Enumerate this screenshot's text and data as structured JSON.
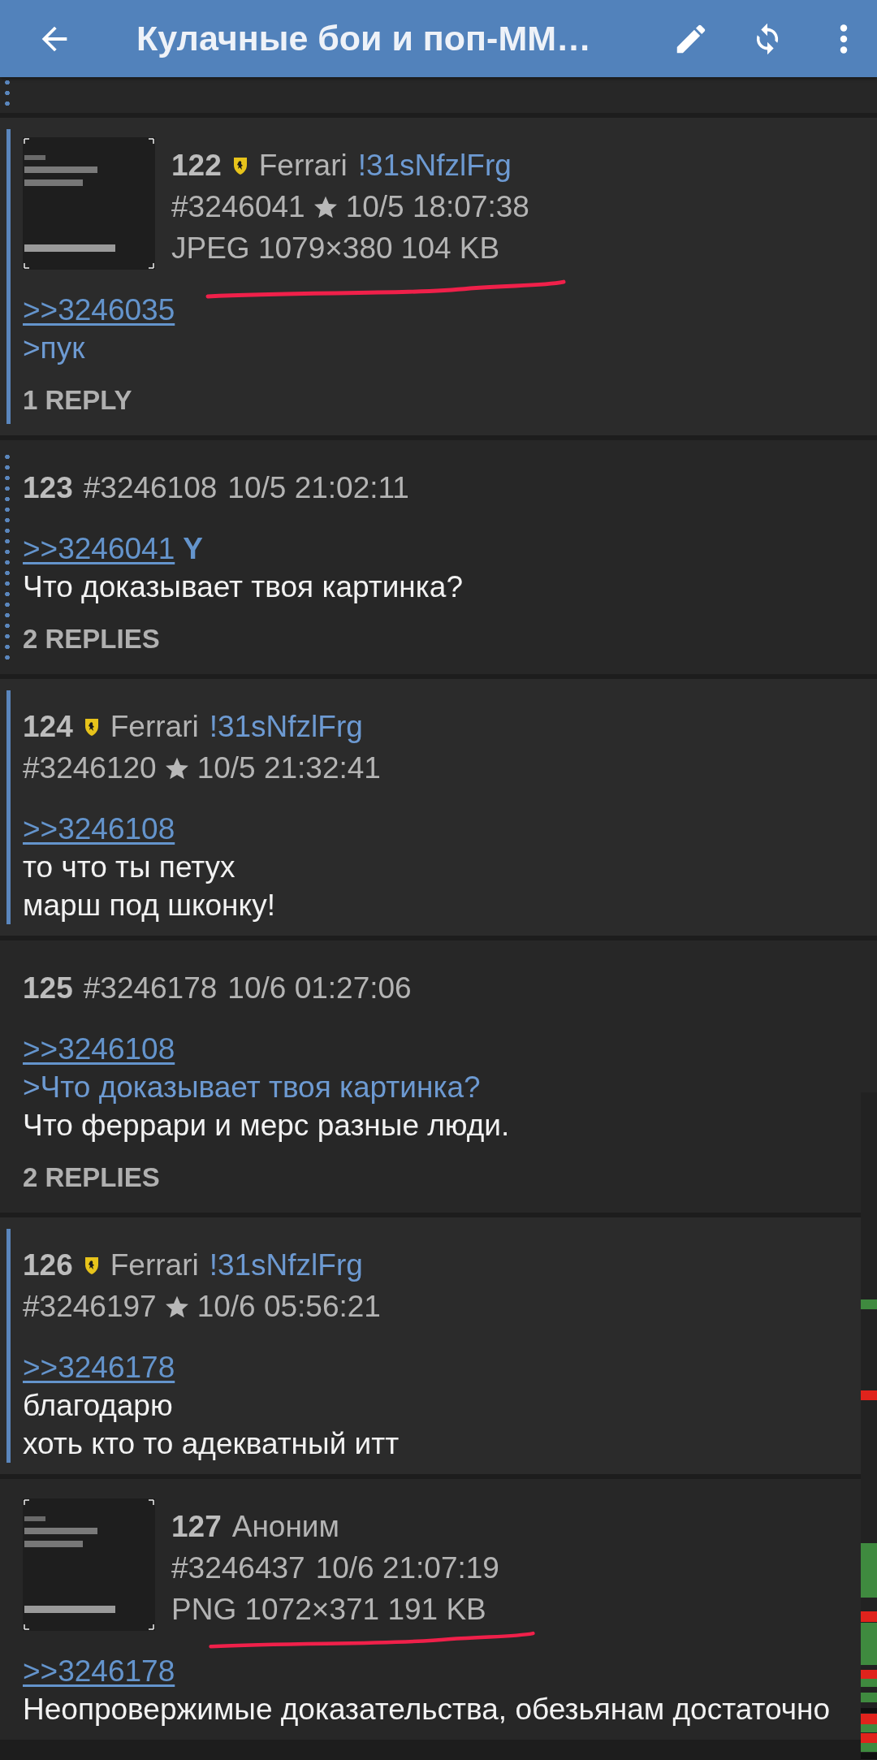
{
  "toolbar": {
    "title": "Кулачные бои и поп-ММ…"
  },
  "posts": [
    {
      "kind": "reply_to_you"
    },
    {
      "kind": "own_post",
      "thumbnail": {
        "kind": "picture"
      },
      "underlined": true,
      "number": "122",
      "flag": true,
      "name": "Ferrari",
      "tripcode": "!31sNfzlFrg",
      "post_id": "#3246041",
      "starred": true,
      "time": "10/5 18:07:38",
      "file_info": "JPEG 1079×380 104 KB",
      "body": [
        {
          "kind": "link",
          "text": ">>3246035"
        },
        {
          "kind": "quote",
          "text": ">пук"
        }
      ],
      "replies": "1 REPLY"
    },
    {
      "kind": "reply_to_you",
      "number": "123",
      "post_id": "#3246108",
      "starred": false,
      "time": "10/5 21:02:11",
      "body": [
        {
          "kind": "link",
          "text": ">>3246041",
          "you": "Y"
        },
        {
          "kind": "text",
          "text": "Что доказывает твоя картинка?"
        }
      ],
      "replies": "2 REPLIES"
    },
    {
      "kind": "own_post",
      "number": "124",
      "flag": true,
      "name": "Ferrari",
      "tripcode": "!31sNfzlFrg",
      "post_id": "#3246120",
      "starred": true,
      "time": "10/5 21:32:41",
      "body": [
        {
          "kind": "link",
          "text": ">>3246108"
        },
        {
          "kind": "text",
          "text": "то что ты петух"
        },
        {
          "kind": "text",
          "text": "марш под шконку!"
        }
      ]
    },
    {
      "kind": "plain",
      "number": "125",
      "post_id": "#3246178",
      "starred": false,
      "time": "10/6 01:27:06",
      "body": [
        {
          "kind": "link",
          "text": ">>3246108"
        },
        {
          "kind": "quote",
          "text": ">Что доказывает твоя картинка?"
        },
        {
          "kind": "text",
          "text": "Что феррари и мерс разные люди."
        }
      ],
      "replies": "2 REPLIES"
    },
    {
      "kind": "own_post",
      "number": "126",
      "flag": true,
      "name": "Ferrari",
      "tripcode": "!31sNfzlFrg",
      "post_id": "#3246197",
      "starred": true,
      "time": "10/6 05:56:21",
      "body": [
        {
          "kind": "link",
          "text": ">>3246178"
        },
        {
          "kind": "text",
          "text": "благодарю"
        },
        {
          "kind": "text",
          "text": "хоть кто то адекватный итт"
        }
      ]
    },
    {
      "kind": "plain",
      "thumbnail": {
        "kind": "picture"
      },
      "underlined": true,
      "number": "127",
      "name": "Аноним",
      "post_id": "#3246437",
      "starred": false,
      "time": "10/6 21:07:19",
      "file_info": "PNG 1072×371 191 KB",
      "body": [
        {
          "kind": "link",
          "text": ">>3246178"
        },
        {
          "kind": "text",
          "text": "Неопровержимые доказательства, обезьянам достаточно"
        }
      ]
    }
  ]
}
